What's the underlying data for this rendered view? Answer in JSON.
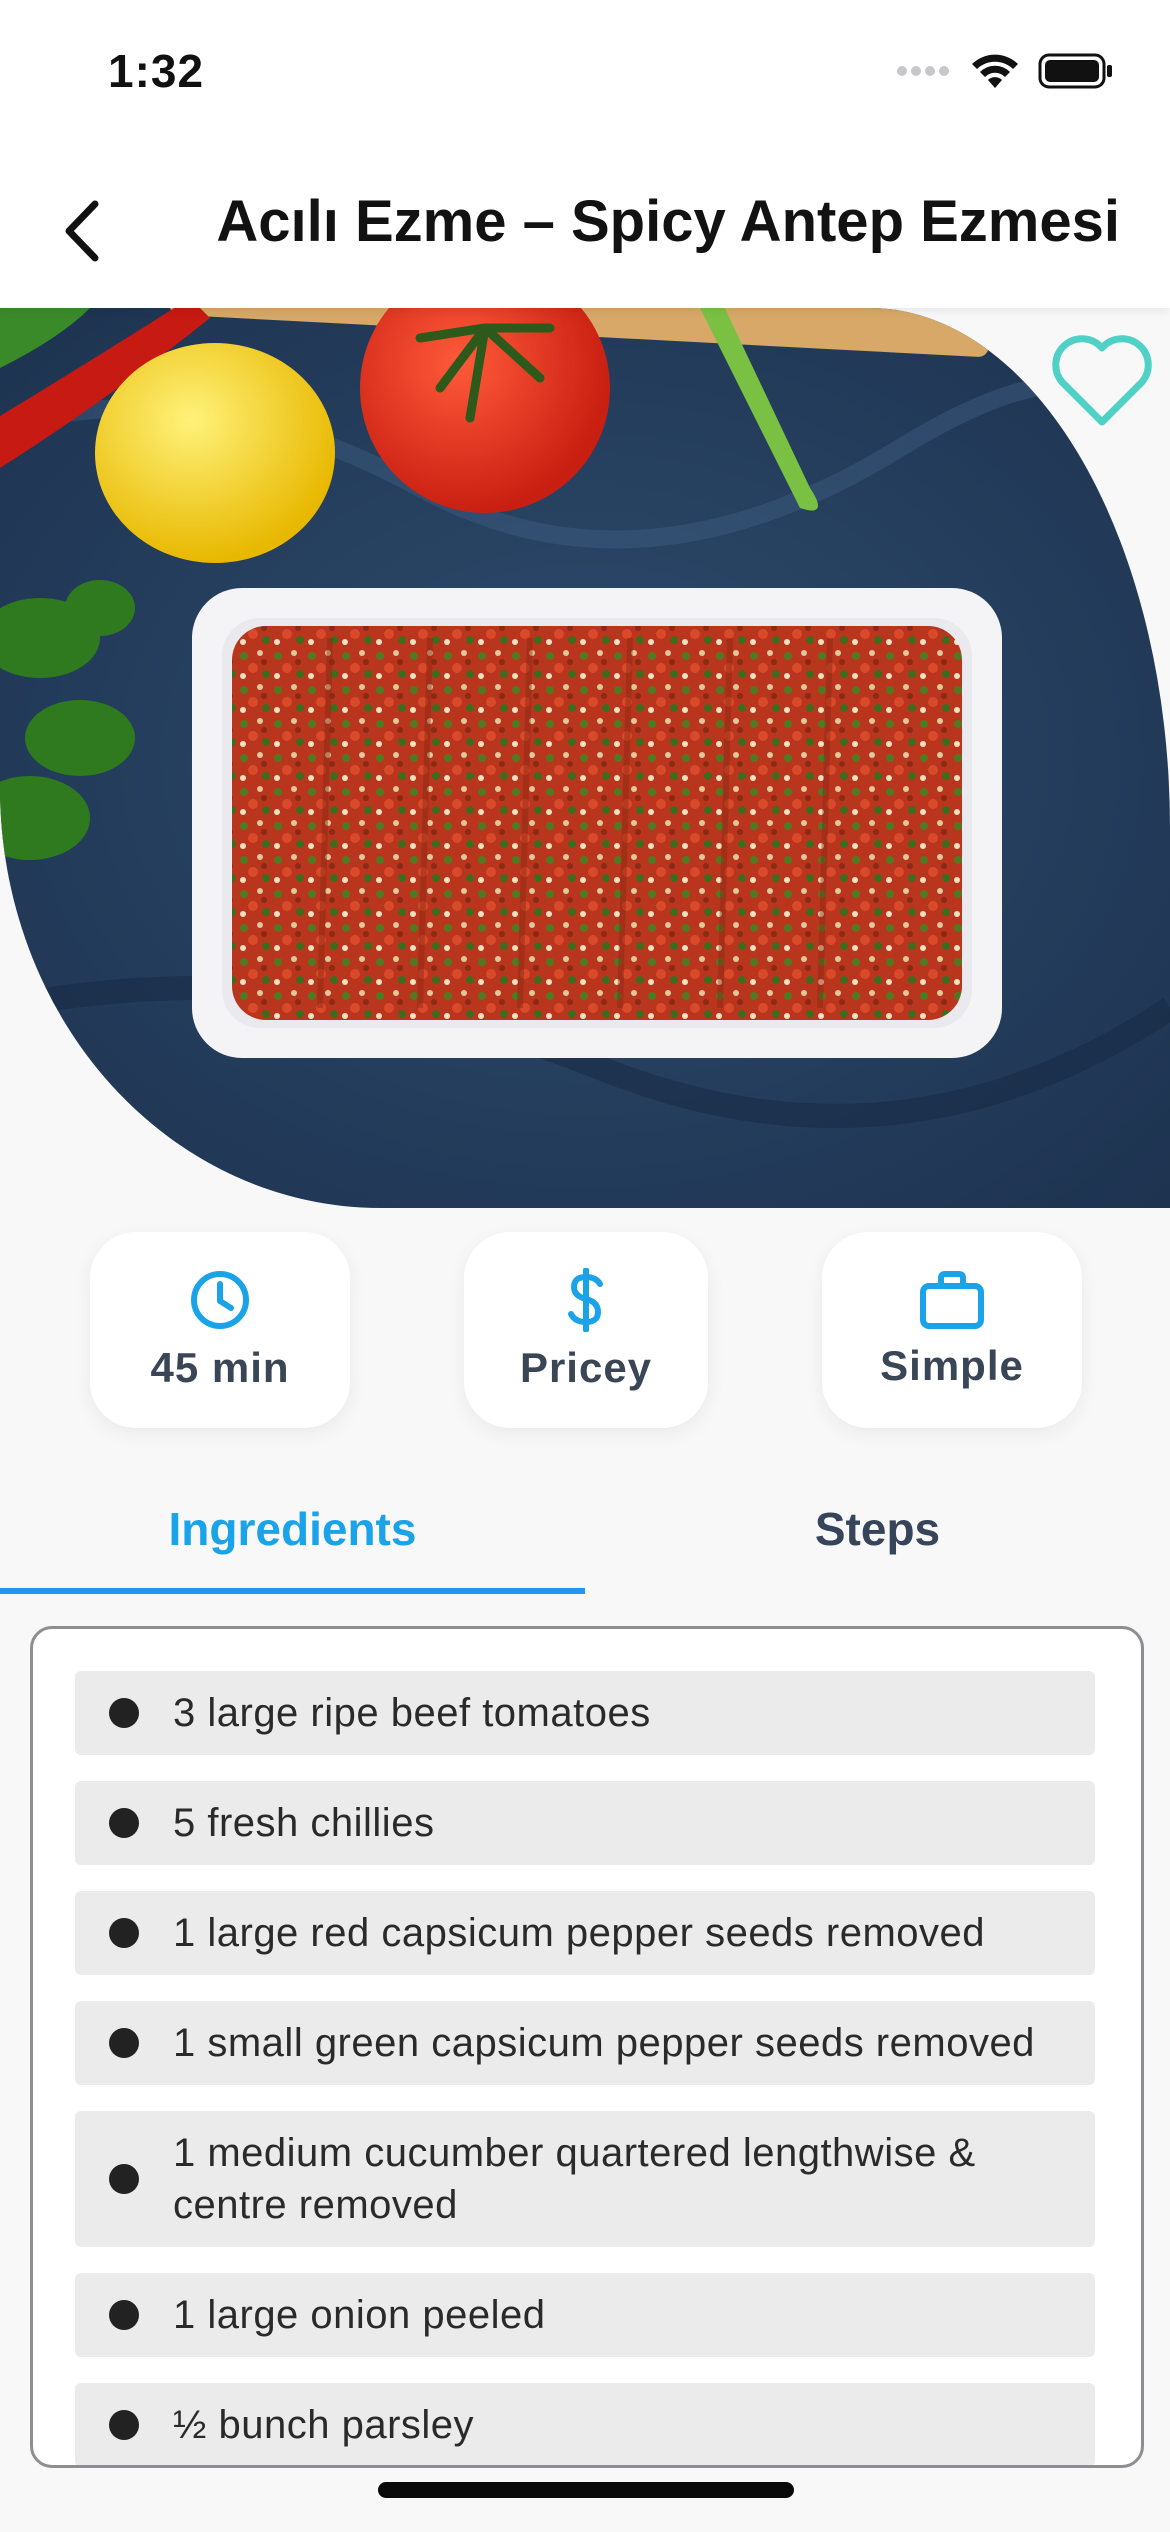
{
  "status_bar": {
    "time": "1:32"
  },
  "nav": {
    "title": "Acılı Ezme – Spicy Antep Ezmesi",
    "back_icon": "chevron-left-icon"
  },
  "hero": {
    "favorite_icon": "heart-outline-icon",
    "favorite_color": "#4fd1c5"
  },
  "info": {
    "duration": "45 min",
    "affordability": "Pricey",
    "complexity": "Simple",
    "icon_color": "#1aa3e8"
  },
  "tabs": [
    {
      "label": "Ingredients",
      "active": true
    },
    {
      "label": "Steps",
      "active": false
    }
  ],
  "ingredients": [
    "3 large ripe beef tomatoes",
    "5 fresh chillies",
    "1 large red capsicum pepper seeds removed",
    "1 small green capsicum pepper seeds removed",
    "1 medium cucumber quartered lengthwise & centre removed",
    "1 large onion peeled",
    "½ bunch parsley"
  ]
}
